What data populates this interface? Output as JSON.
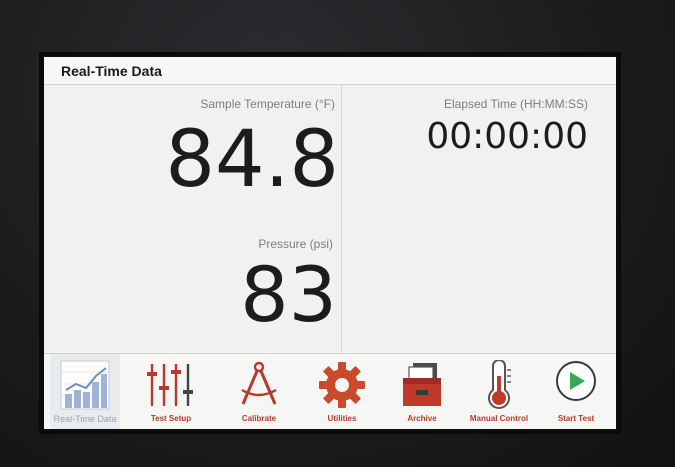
{
  "header": {
    "title": "Real-Time Data"
  },
  "readouts": {
    "temperature": {
      "label": "Sample Temperature (°F)",
      "value": "84.8"
    },
    "pressure": {
      "label": "Pressure (psi)",
      "value": "83"
    },
    "elapsed": {
      "label": "Elapsed Time (HH:MM:SS)",
      "value": "00:00:00"
    }
  },
  "nav": {
    "items": [
      {
        "label": "Real-Time Data",
        "icon": "bar-chart-icon",
        "active": true
      },
      {
        "label": "Test Setup",
        "icon": "sliders-icon"
      },
      {
        "label": "Calibrate",
        "icon": "compass-icon"
      },
      {
        "label": "Utilities",
        "icon": "gear-icon"
      },
      {
        "label": "Archive",
        "icon": "archive-box-icon"
      },
      {
        "label": "Manual Control",
        "icon": "thermometer-icon"
      },
      {
        "label": "Start Test",
        "icon": "play-icon"
      }
    ]
  },
  "colors": {
    "accent": "#c0392b",
    "play": "#3aa657",
    "chart_blue": "#9db4d6",
    "screen_bg": "#f3f3f1"
  }
}
